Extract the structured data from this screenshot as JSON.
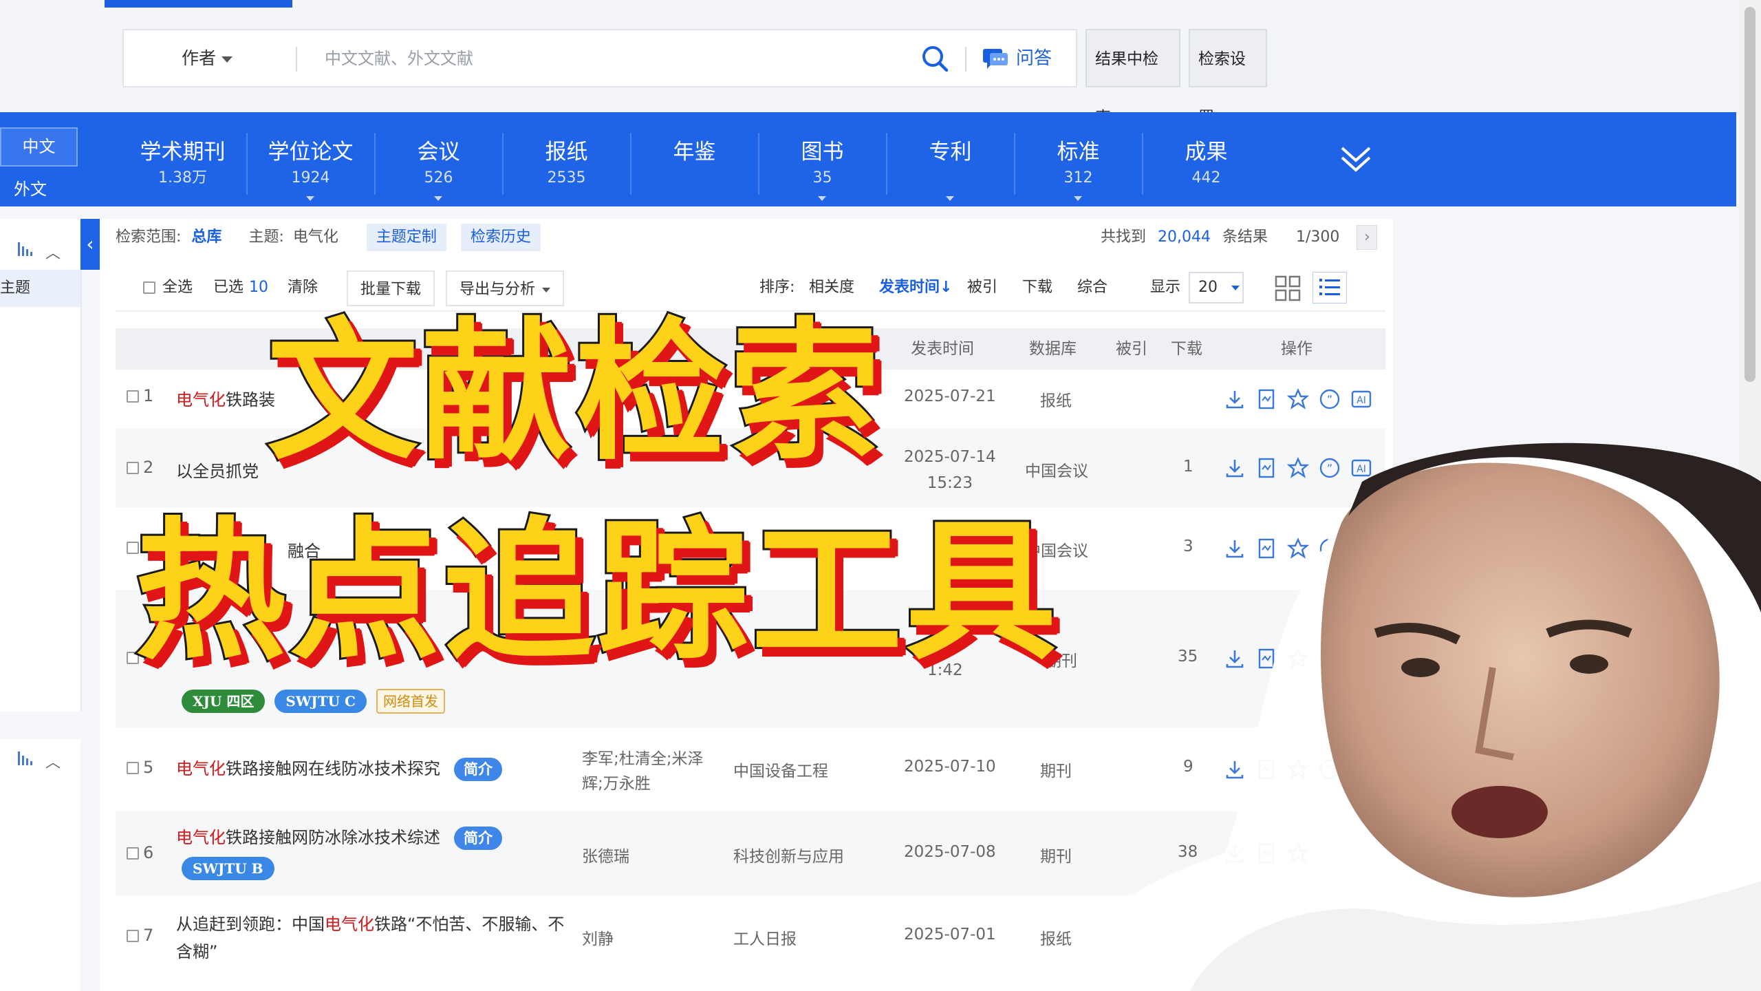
{
  "search": {
    "field": "作者",
    "placeholder": "中文文献、外文文献",
    "qa_label": "问答",
    "result_search": "结果中检索",
    "settings": "检索设置"
  },
  "lang": {
    "cn": "中文",
    "en": "外文"
  },
  "categories": [
    {
      "label": "学术期刊",
      "count": "1.38万"
    },
    {
      "label": "学位论文",
      "count": "1924"
    },
    {
      "label": "会议",
      "count": "526"
    },
    {
      "label": "报纸",
      "count": "2535"
    },
    {
      "label": "年鉴",
      "count": ""
    },
    {
      "label": "图书",
      "count": "35"
    },
    {
      "label": "专利",
      "count": ""
    },
    {
      "label": "标准",
      "count": "312"
    },
    {
      "label": "成果",
      "count": "442"
    }
  ],
  "sidebar": {
    "item": "主题"
  },
  "scope": {
    "label": "检索范围:",
    "db": "总库",
    "topic_label": "主题:",
    "topic": "电气化",
    "custom": "主题定制",
    "history": "检索历史"
  },
  "results": {
    "found_label": "共找到",
    "count": "20,044",
    "unit": "条结果",
    "page": "1/300"
  },
  "toolbar": {
    "select_all": "全选",
    "selected_label": "已选",
    "selected_count": "10",
    "clear": "清除",
    "batch_download": "批量下载",
    "export": "导出与分析",
    "sort_label": "排序:",
    "sort_relevance": "相关度",
    "sort_date": "发表时间",
    "sort_cited": "被引",
    "sort_download": "下载",
    "sort_overall": "综合",
    "show_label": "显示",
    "page_size": "20"
  },
  "table_head": {
    "date": "发表时间",
    "db": "数据库",
    "cited": "被引",
    "download": "下载",
    "ops": "操作"
  },
  "rows": [
    {
      "num": "1",
      "title_hl": "电气化",
      "title_rest": "铁路装",
      "date": "2025-07-21",
      "time": "",
      "db": "报纸",
      "cited": ""
    },
    {
      "num": "2",
      "title_hl": "",
      "title_rest": "以全员抓党",
      "date": "2025-07-14",
      "time": "15:23",
      "db": "中国会议",
      "cited": "1"
    },
    {
      "num": "3",
      "title_hl": "",
      "title_rest": "融合",
      "date": "",
      "time": "",
      "db": "中国会议",
      "cited": "3"
    },
    {
      "num": "4",
      "title_hl": "",
      "title_rest": "",
      "date": "",
      "time": "1:42",
      "db": "期刊",
      "cited": "35"
    },
    {
      "num": "5",
      "title_hl": "电气化",
      "title_rest": "铁路接触网在线防冰技术探究",
      "badge": "简介",
      "authors": "李军;杜清全;米泽辉;万永胜",
      "source": "中国设备工程",
      "date": "2025-07-10",
      "db": "期刊",
      "cited": "9"
    },
    {
      "num": "6",
      "title_hl": "电气化",
      "title_rest": "铁路接触网防冰除冰技术综述",
      "badge": "简介",
      "authors": "张德瑞",
      "source": "科技创新与应用",
      "date": "2025-07-08",
      "db": "期刊",
      "cited": "38"
    },
    {
      "num": "7",
      "title_pre": "从追赶到领跑：中国",
      "title_hl": "电气化",
      "title_rest": "铁路“不怕苦、不服输、不含糊”",
      "authors": "刘静",
      "source": "工人日报",
      "date": "2025-07-01",
      "db": "报纸",
      "cited": ""
    }
  ],
  "tags": {
    "xju": "XJU 四区",
    "swjtu_c": "SWJTU C",
    "online": "网络首发",
    "swjtu_b": "SWJTU B"
  },
  "overlay": {
    "line1": "文献检索",
    "line2": "热点追踪工具"
  },
  "colors": {
    "brand_blue": "#1f63e6",
    "highlight_red": "#d21a1a",
    "overlay_yellow": "#ffd21a"
  }
}
